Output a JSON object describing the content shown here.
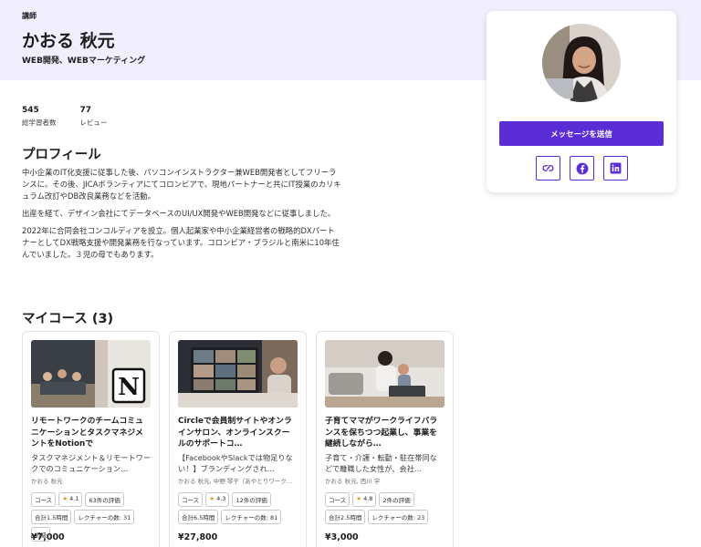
{
  "header": {
    "role": "講師",
    "name": "かおる 秋元",
    "subtitle": "WEB開発、WEBマーケティング"
  },
  "stats": [
    {
      "value": "545",
      "label": "総学習者数"
    },
    {
      "value": "77",
      "label": "レビュー"
    }
  ],
  "profile": {
    "title": "プロフィール",
    "paragraphs": [
      "中小企業のIT化支援に従事した後、パソコンインストラクター兼WEB開発者としてフリーランスに。その後、JICAボランティアにてコロンビアで、現地パートナーと共にIT授業のカリキュラム改訂やDB改良業務などを活動。",
      "出産を経て、デザイン会社にてデータベースのUI/UX開発やWEB開発などに従事しました。",
      "2022年に合同会社コンコルディアを設立。個人起業家や中小企業経営者の戦略的DXパートナーとしてDX戦略支援や開発業務を行なっています。コロンビア・ブラジルと南米に10年住んでいました。３児の母でもあります。"
    ]
  },
  "courses": {
    "title": "マイコース (3)",
    "items": [
      {
        "title": "リモートワークのチームコミュニケーションとタスクマネジメントをNotionで",
        "desc": "タスクマネジメント＆リモートワークでのコミュニケーション…",
        "author": "かおる 秋元",
        "type": "コース",
        "rating": "4.1",
        "reviews": "63件の評価",
        "hours": "合計1.5時間",
        "lectures": "レクチャーの数: 31",
        "level": "初級",
        "price": "¥7,000"
      },
      {
        "title": "Circleで会員制サイトやオンラインサロン、オンラインスクールのサポートコ…",
        "desc": "【FacebookやSlackでは物足りない！】ブランディングされ…",
        "author": "かおる 秋元, 中野 琴子（あやとりワーク…",
        "type": "コース",
        "rating": "4.3",
        "reviews": "12件の評価",
        "hours": "合計6.5時間",
        "lectures": "レクチャーの数: 81",
        "level": "",
        "price": "¥27,800"
      },
      {
        "title": "子育てママがワークライフバランスを保ちつつ起業し、事業を継続しながら…",
        "desc": "子育て・介護・転勤・駐在帯同などで離職した女性が、会社…",
        "author": "かおる 秋元, 西川 学",
        "type": "コース",
        "rating": "4.8",
        "reviews": "2件の評価",
        "hours": "合計2.5時間",
        "lectures": "レクチャーの数: 23",
        "level": "",
        "price": "¥3,000"
      }
    ]
  },
  "sidebar": {
    "message_button": "メッセージを送信",
    "icons": [
      "link-icon",
      "facebook-icon",
      "linkedin-icon"
    ]
  },
  "colors": {
    "accent": "#5b2dd6",
    "hero_bg": "#f1effd"
  }
}
